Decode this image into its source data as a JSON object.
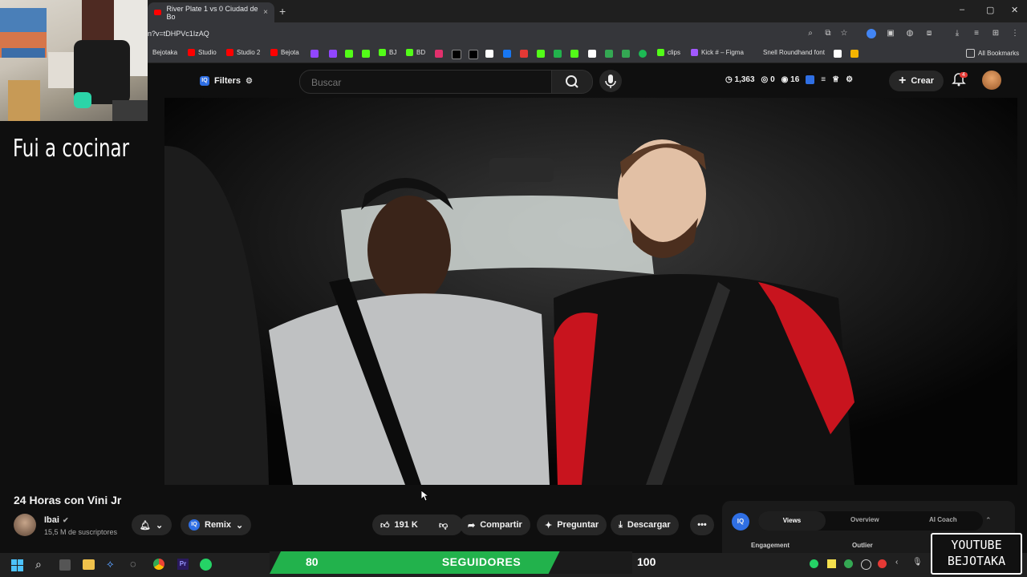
{
  "browser": {
    "tab_title": "River Plate 1 vs 0 Ciudad de Bo",
    "tab_close": "×",
    "new_tab": "+",
    "url": "n?v=tDHPVc1IzAQ",
    "window_controls": [
      "–",
      "▢",
      "✕"
    ],
    "bookmarks": [
      "Bejotaka",
      "Studio",
      "Studio 2",
      "Bejota",
      "BJ",
      "BD",
      "clips",
      "Kick # – Figma",
      "Snell Roundhand font"
    ],
    "all_bookmarks": "All Bookmarks"
  },
  "overlay": {
    "side_text": "Fui a cocinar",
    "follower_left": "80",
    "follower_label": "SEGUIDORES",
    "follower_right": "100",
    "follower_progress": 0.8,
    "watermark_line1": "YOUTUBE",
    "watermark_line2": "BEJOTAKA"
  },
  "masthead": {
    "filters_label": "Filters",
    "search_placeholder": "Buscar",
    "stat_time": "1,363",
    "stat_zero": "0",
    "stat_views": "16",
    "create_label": "Crear",
    "notif_count": "4"
  },
  "video": {
    "title": "24 Horas con Vini Jr",
    "channel_name": "Ibai",
    "subscribers": "15,5 M de suscriptores",
    "remix_label": "Remix",
    "likes": "191 K",
    "share_label": "Compartir",
    "ask_label": "Preguntar",
    "download_label": "Descargar"
  },
  "insights": {
    "tabs": [
      "Views",
      "Overview",
      "AI Coach"
    ],
    "active_tab": "Views",
    "label_engagement": "Engagement",
    "label_outlier": "Outlier"
  },
  "colors": {
    "accent_green": "#22b24c",
    "youtube_red": "#ff0000",
    "badge_red": "#e53935",
    "vidiq_blue": "#2f6fe4"
  }
}
